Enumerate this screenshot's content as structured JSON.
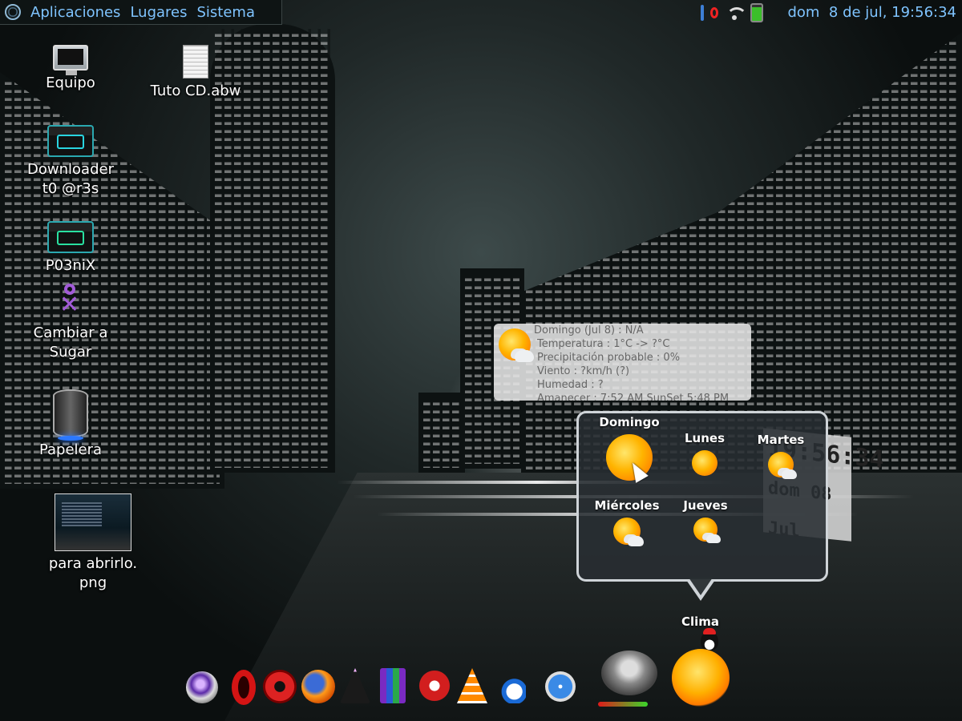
{
  "top_panel": {
    "menus": [
      "Aplicaciones",
      "Lugares",
      "Sistema"
    ],
    "clock": "dom  8 de jul, 19:56:34",
    "tray": [
      "bluetooth-icon",
      "opera-icon",
      "wifi-icon",
      "battery-icon"
    ]
  },
  "desktop_icons": [
    {
      "label": "Equipo",
      "icon": "computer-icon"
    },
    {
      "label": "Tuto CD.abw",
      "icon": "document-icon"
    },
    {
      "label": "Downloader\nt0 @r3s",
      "icon": "folder-icon"
    },
    {
      "label": "P03niX",
      "icon": "home-folder-icon"
    },
    {
      "label": "Cambiar a\nSugar",
      "icon": "sugar-icon"
    },
    {
      "label": "Papelera",
      "icon": "trash-icon"
    },
    {
      "label": "para abrirlo.\npng",
      "icon": "image-thumbnail-icon"
    }
  ],
  "weather_tooltip": {
    "lines": [
      "Domingo (Jul 8) : N/A",
      "Temperatura : 1°C -> ?°C",
      "Precipitación probable : 0%",
      "Viento : ?km/h (?)",
      "Humedad : ?",
      "Amanecer : 7:52 AM  SunSet 5:48 PM"
    ]
  },
  "weather_popup": {
    "days": [
      {
        "name": "Domingo",
        "icon": "sunny-icon"
      },
      {
        "name": "Lunes",
        "icon": "sunny-icon"
      },
      {
        "name": "Martes",
        "icon": "partly-cloudy-icon"
      },
      {
        "name": "Miércoles",
        "icon": "partly-cloudy-icon"
      },
      {
        "name": "Jueves",
        "icon": "partly-cloudy-icon"
      }
    ]
  },
  "clock_widget": {
    "line1": "19:56:34",
    "line2": "dom 08 Jul"
  },
  "dock": {
    "label": "Clima",
    "items": [
      "pidgin-icon",
      "opera-icon",
      "ubuntu-software-icon",
      "firefox-icon",
      "inkscape-icon",
      "winrar-icon",
      "ccleaner-icon",
      "vlc-icon",
      "blogger-icon",
      "safari-icon",
      "speaker-icon",
      "weather-sun-icon"
    ],
    "colors": {
      "accent": "#7fc4ff"
    }
  }
}
